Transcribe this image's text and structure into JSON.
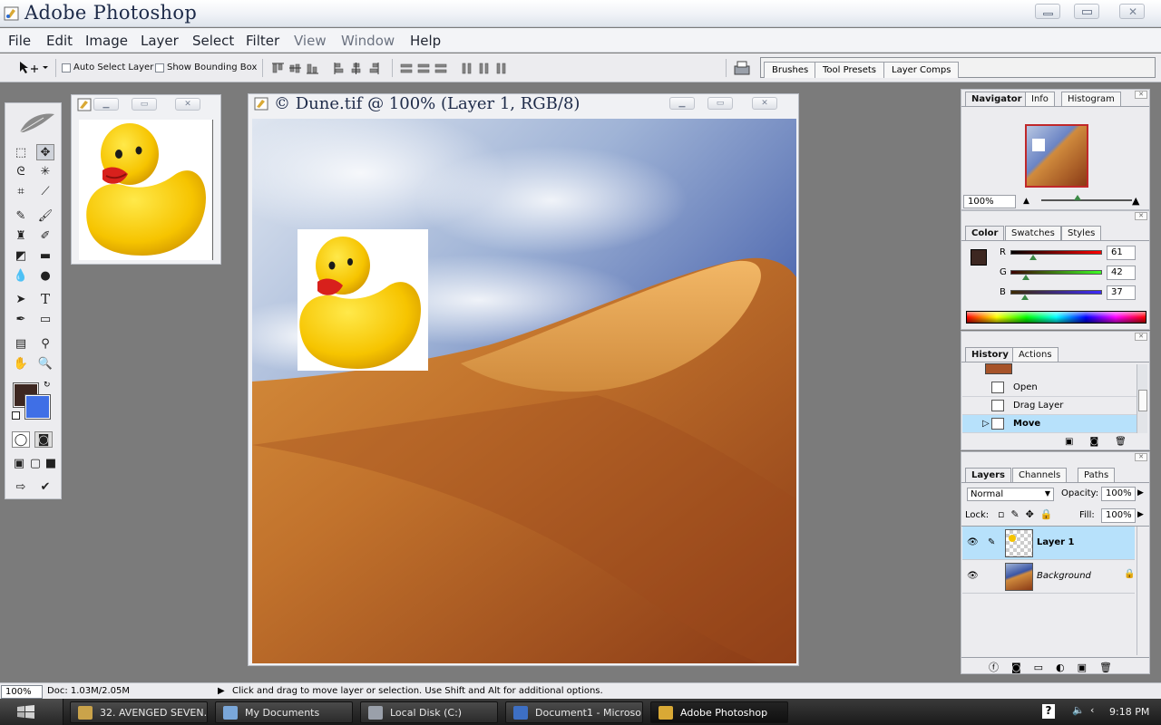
{
  "app": {
    "title": "Adobe Photoshop"
  },
  "menu": [
    "File",
    "Edit",
    "Image",
    "Layer",
    "Select",
    "Filter",
    "View",
    "Window",
    "Help"
  ],
  "options": {
    "auto_select_label": "Auto Select Layer",
    "bounding_box_label": "Show Bounding Box",
    "well_tabs": [
      "Brushes",
      "Tool Presets",
      "Layer Comps"
    ]
  },
  "document": {
    "title": "© Dune.tif @ 100% (Layer 1, RGB/8)"
  },
  "navigator": {
    "tabs": [
      "Navigator",
      "Info",
      "Histogram"
    ],
    "zoom": "100%"
  },
  "color": {
    "tabs": [
      "Color",
      "Swatches",
      "Styles"
    ],
    "channels": [
      {
        "label": "R",
        "value": "61"
      },
      {
        "label": "G",
        "value": "42"
      },
      {
        "label": "B",
        "value": "37"
      }
    ],
    "foreground": "#3d2721",
    "background": "#3f6fe6"
  },
  "history": {
    "tabs": [
      "History",
      "Actions"
    ],
    "items": [
      "Open",
      "Drag Layer",
      "Move"
    ]
  },
  "layers": {
    "tabs": [
      "Layers",
      "Channels",
      "Paths"
    ],
    "blend_mode": "Normal",
    "opacity_label": "Opacity:",
    "opacity": "100%",
    "lock_label": "Lock:",
    "fill_label": "Fill:",
    "fill": "100%",
    "items": [
      {
        "name": "Layer 1"
      },
      {
        "name": "Background"
      }
    ]
  },
  "status": {
    "zoom": "100%",
    "doc_info": "Doc: 1.03M/2.05M",
    "hint": "Click and drag to move layer or selection.  Use Shift and Alt for additional options."
  },
  "taskbar": {
    "tasks": [
      "32. AVENGED SEVEN...",
      "My Documents",
      "Local Disk (C:)",
      "Document1 - Microso...",
      "Adobe Photoshop"
    ],
    "time": "9:18 PM"
  }
}
